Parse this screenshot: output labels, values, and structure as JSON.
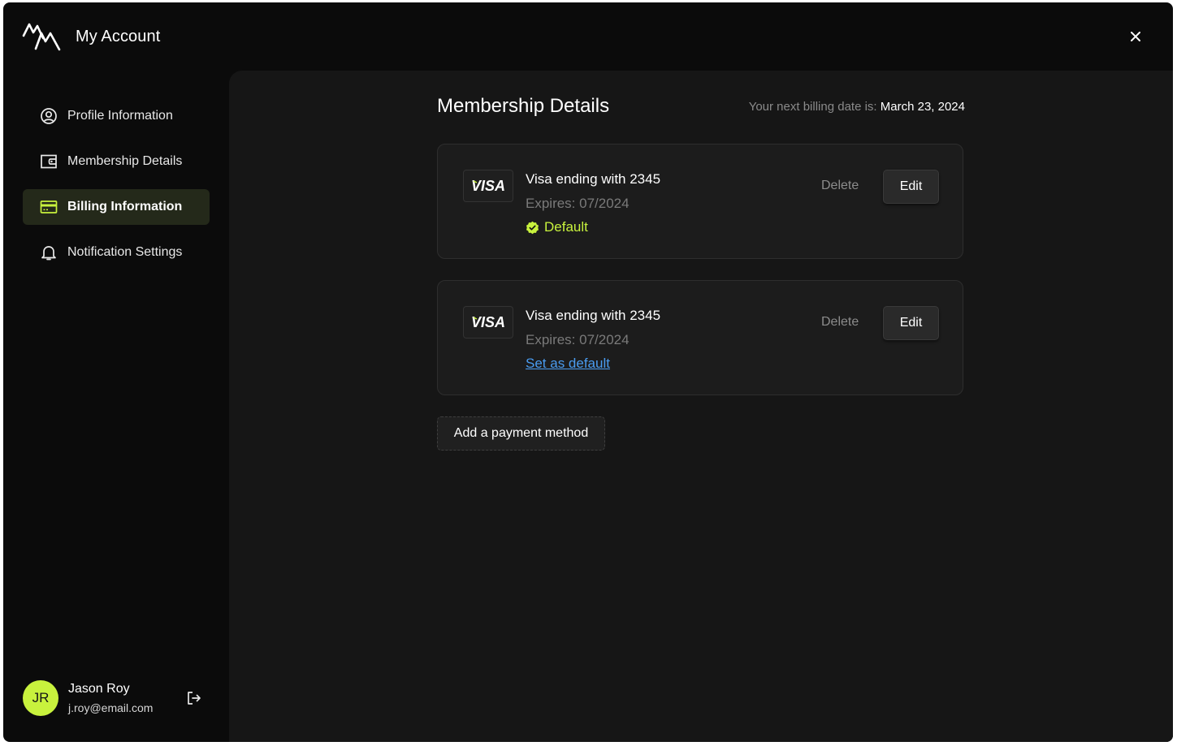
{
  "app": {
    "title": "My Account",
    "logo": "mountain-logo-icon",
    "close_icon": "close-icon"
  },
  "sidebar": {
    "items": [
      {
        "label": "Profile Information",
        "icon": "user-circle-icon",
        "active": false
      },
      {
        "label": "Membership Details",
        "icon": "wallet-icon",
        "active": false
      },
      {
        "label": "Billing Information",
        "icon": "credit-card-icon",
        "active": true
      },
      {
        "label": "Notification Settings",
        "icon": "bell-icon",
        "active": false
      }
    ],
    "user": {
      "initials": "JR",
      "name": "Jason Roy",
      "email": "j.roy@email.com",
      "logout_icon": "logout-icon"
    }
  },
  "main": {
    "title": "Membership Details",
    "billing_label": "Your next billing date is:",
    "billing_date": "March 23, 2024",
    "cards": [
      {
        "brand": "VISA",
        "title": "Visa ending with 2345",
        "expiry": "Expires: 07/2024",
        "is_default": true,
        "default_label": "Default",
        "delete_label": "Delete",
        "edit_label": "Edit"
      },
      {
        "brand": "VISA",
        "title": "Visa ending with 2345",
        "expiry": "Expires: 07/2024",
        "is_default": false,
        "set_default_label": "Set as default",
        "delete_label": "Delete",
        "edit_label": "Edit"
      }
    ],
    "add_payment_label": "Add a payment method"
  },
  "colors": {
    "accent": "#c8f23d",
    "link": "#4a9cf0",
    "window_bg": "#0b0b0b",
    "panel_bg": "#161616",
    "card_bg": "#1c1c1c",
    "active_nav_bg": "#24291a"
  }
}
